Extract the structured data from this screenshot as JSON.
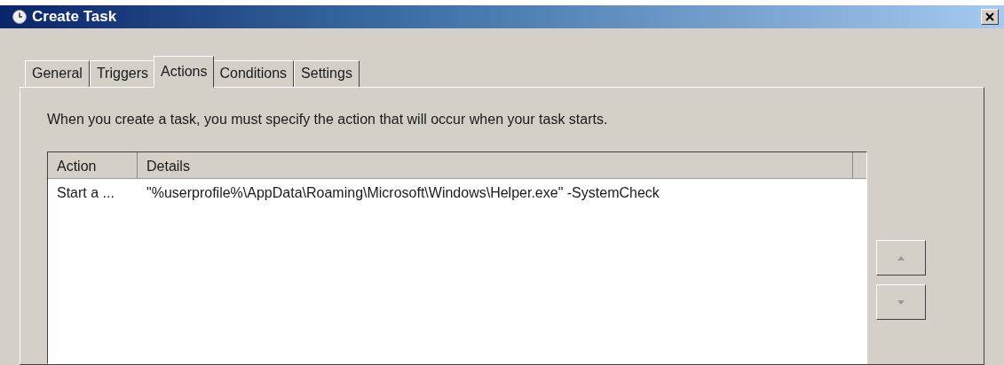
{
  "window": {
    "title": "Create Task"
  },
  "tabs": [
    {
      "label": "General",
      "selected": false
    },
    {
      "label": "Triggers",
      "selected": false
    },
    {
      "label": "Actions",
      "selected": true
    },
    {
      "label": "Conditions",
      "selected": false
    },
    {
      "label": "Settings",
      "selected": false
    }
  ],
  "instruction": "When you create a task, you must specify the action that will occur when your task starts.",
  "table": {
    "columns": [
      "Action",
      "Details"
    ],
    "rows": [
      {
        "cells": [
          "Start a ...",
          "\"%userprofile%\\AppData\\Roaming\\Microsoft\\Windows\\Helper.exe\" -SystemCheck"
        ]
      }
    ]
  }
}
